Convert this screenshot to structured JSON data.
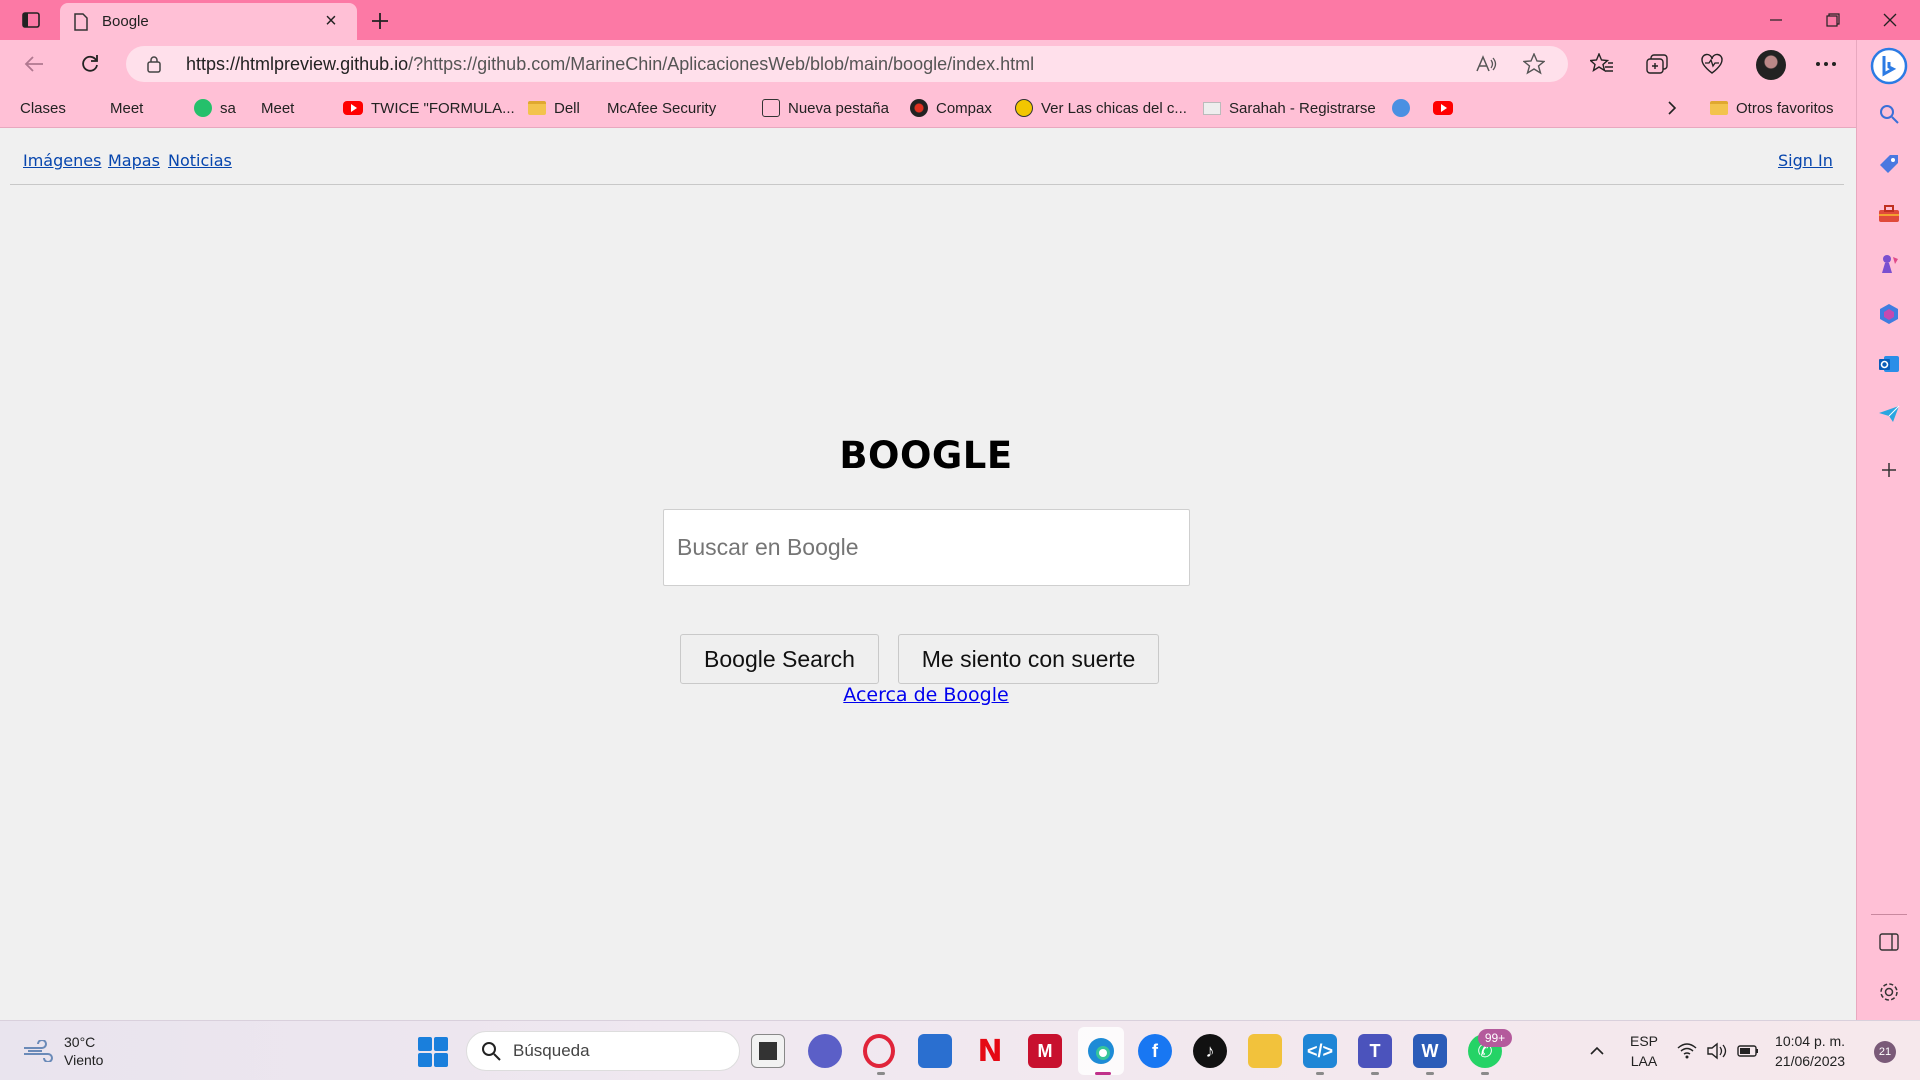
{
  "browser": {
    "tab_title": "Boogle",
    "url_host": "https://htmlpreview.github.io",
    "url_rest": "/?https://github.com/MarineChin/AplicacionesWeb/blob/main/boogle/index.html",
    "accent_color": "#fc79a5",
    "toolbar_color": "#ffc0d6"
  },
  "favorites": [
    {
      "label": "Clases",
      "icon": "page-icon"
    },
    {
      "label": "Meet",
      "icon": "page-icon"
    },
    {
      "label": "sa",
      "icon": "chat-badge-icon"
    },
    {
      "label": "Meet",
      "icon": "page-icon"
    },
    {
      "label": "TWICE \"FORMULA...",
      "icon": "youtube-icon"
    },
    {
      "label": "Dell",
      "icon": "folder-icon"
    },
    {
      "label": "McAfee Security",
      "icon": "page-icon"
    },
    {
      "label": "Nueva pestaña",
      "icon": "calendar-icon"
    },
    {
      "label": "Compax",
      "icon": "compax-icon"
    },
    {
      "label": "Ver Las chicas del c...",
      "icon": "play-icon"
    },
    {
      "label": "Sarahah - Registrarse",
      "icon": "envelope-icon"
    }
  ],
  "other_favorites": "Otros favoritos",
  "page": {
    "nav": {
      "images": "Imágenes",
      "maps": "Mapas",
      "news": "Noticias",
      "sign_in": "Sign In"
    },
    "logo": "BOOGLE",
    "search_placeholder": "Buscar en Boogle",
    "search_button": "Boogle Search",
    "lucky_button": "Me siento con suerte",
    "about_link": "Acerca de Boogle"
  },
  "taskbar": {
    "weather_temp": "30°C",
    "weather_desc": "Viento",
    "search_label": "Búsqueda",
    "whatsapp_badge": "99+",
    "lang_top": "ESP",
    "lang_bottom": "LAA",
    "time": "10:04 p. m.",
    "date": "21/06/2023",
    "notification_count": "21"
  }
}
